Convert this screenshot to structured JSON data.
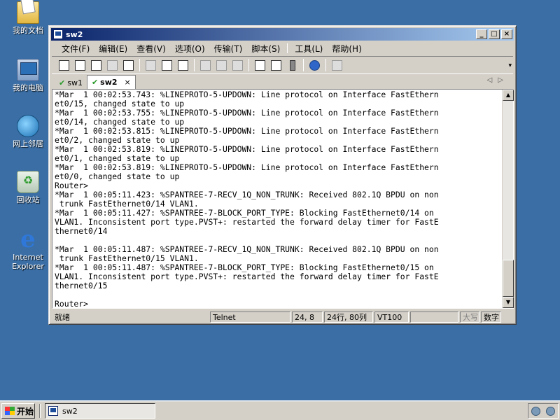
{
  "desktop": {
    "icons": [
      {
        "label": "我的文档"
      },
      {
        "label": "我的电脑"
      },
      {
        "label": "网上邻居"
      },
      {
        "label": "回收站"
      },
      {
        "label": "Internet Explorer"
      }
    ]
  },
  "window": {
    "title": "sw2",
    "controls": {
      "minimize": "_",
      "maximize": "□",
      "close": "×"
    },
    "menu": [
      "文件(F)",
      "编辑(E)",
      "查看(V)",
      "选项(O)",
      "传输(T)",
      "脚本(S)",
      "工具(L)",
      "帮助(H)"
    ],
    "tabs": [
      {
        "label": "sw1",
        "active": false
      },
      {
        "label": "sw2",
        "active": true,
        "close": "×"
      }
    ],
    "terminal_lines": [
      "*Mar  1 00:02:53.743: %LINEPROTO-5-UPDOWN: Line protocol on Interface FastEthern",
      "et0/15, changed state to up",
      "*Mar  1 00:02:53.755: %LINEPROTO-5-UPDOWN: Line protocol on Interface FastEthern",
      "et0/14, changed state to up",
      "*Mar  1 00:02:53.815: %LINEPROTO-5-UPDOWN: Line protocol on Interface FastEthern",
      "et0/2, changed state to up",
      "*Mar  1 00:02:53.819: %LINEPROTO-5-UPDOWN: Line protocol on Interface FastEthern",
      "et0/1, changed state to up",
      "*Mar  1 00:02:53.819: %LINEPROTO-5-UPDOWN: Line protocol on Interface FastEthern",
      "et0/0, changed state to up",
      "Router>",
      "*Mar  1 00:05:11.423: %SPANTREE-7-RECV_1Q_NON_TRUNK: Received 802.1Q BPDU on non",
      " trunk FastEthernet0/14 VLAN1.",
      "*Mar  1 00:05:11.427: %SPANTREE-7-BLOCK_PORT_TYPE: Blocking FastEthernet0/14 on",
      "VLAN1. Inconsistent port type.PVST+: restarted the forward delay timer for FastE",
      "thernet0/14",
      "",
      "*Mar  1 00:05:11.487: %SPANTREE-7-RECV_1Q_NON_TRUNK: Received 802.1Q BPDU on non",
      " trunk FastEthernet0/15 VLAN1.",
      "*Mar  1 00:05:11.487: %SPANTREE-7-BLOCK_PORT_TYPE: Blocking FastEthernet0/15 on",
      "VLAN1. Inconsistent port type.PVST+: restarted the forward delay timer for FastE",
      "thernet0/15",
      "",
      "Router>"
    ],
    "status": {
      "ready": "就绪",
      "protocol": "Telnet",
      "cursor": "24,  8",
      "size": "24行, 80列",
      "emulation": "VT100",
      "caps": "大写",
      "num": "数字"
    }
  },
  "taskbar": {
    "start": "开始",
    "task": "sw2"
  }
}
